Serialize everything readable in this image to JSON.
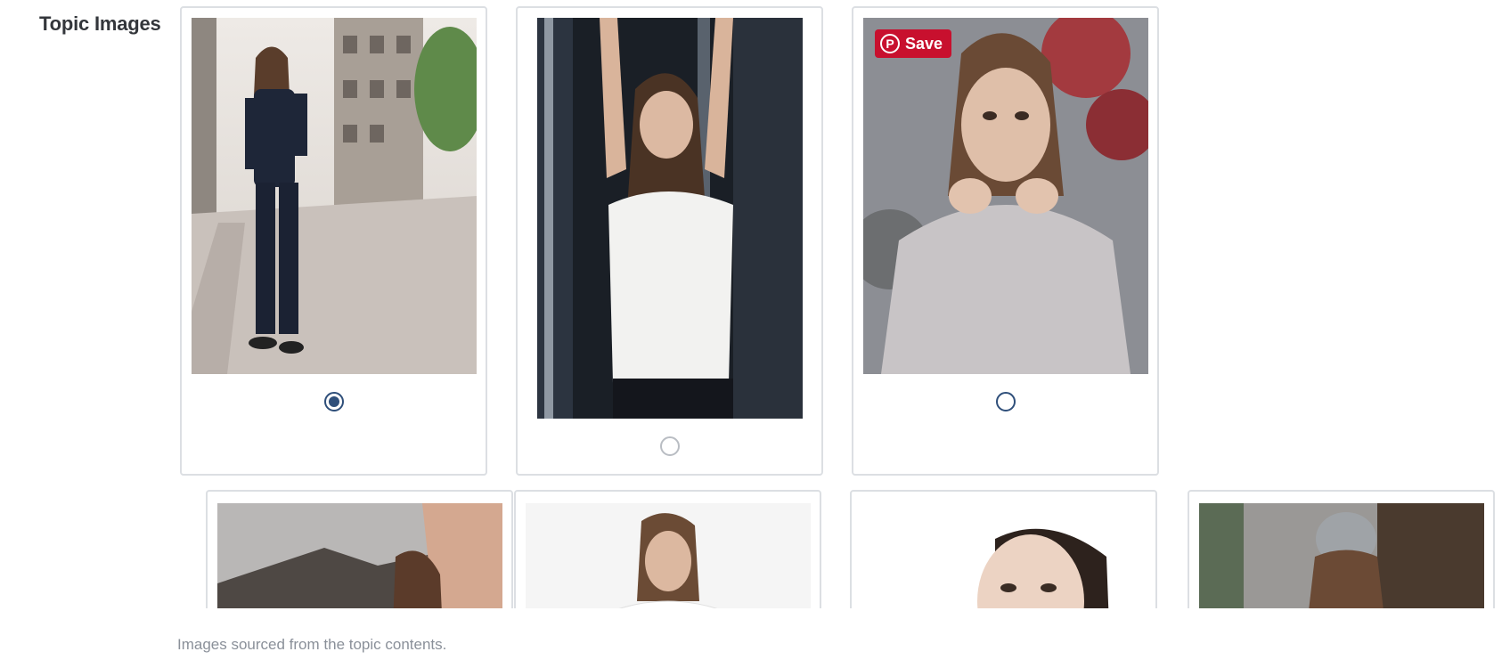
{
  "section": {
    "label": "Topic Images",
    "helper_text": "Images sourced from the topic contents."
  },
  "images": [
    {
      "selected": true,
      "muted": false,
      "has_save_button": false
    },
    {
      "selected": false,
      "muted": true,
      "has_save_button": false
    },
    {
      "selected": false,
      "muted": false,
      "has_save_button": true
    },
    {
      "selected": false,
      "muted": false,
      "has_save_button": false
    },
    {
      "selected": false,
      "muted": false,
      "has_save_button": false
    },
    {
      "selected": false,
      "muted": false,
      "has_save_button": false
    },
    {
      "selected": false,
      "muted": false,
      "has_save_button": false
    }
  ],
  "save_button": {
    "label": "Save",
    "icon": "pinterest-icon",
    "color": "#c8102e"
  },
  "colors": {
    "radio_accent": "#2f4f7a",
    "card_border": "#dcdfe3",
    "helper_text": "#8a9099"
  }
}
